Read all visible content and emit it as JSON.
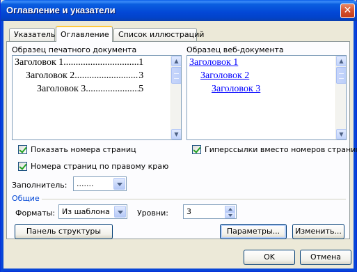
{
  "window": {
    "title": "Оглавление и указатели",
    "close_glyph": "✕"
  },
  "tabs": [
    {
      "label": "Указатель",
      "active": false
    },
    {
      "label": "Оглавление",
      "active": true
    },
    {
      "label": "Список иллюстраций",
      "active": false
    }
  ],
  "print_preview": {
    "label": "Образец печатного документа",
    "lines": [
      {
        "text": "Заголовок 1",
        "dots": "......................................",
        "page": "1"
      },
      {
        "text": "Заголовок 2",
        "dots": "......................................",
        "page": "3"
      },
      {
        "text": "Заголовок 3",
        "dots": "......................................",
        "page": "5"
      }
    ]
  },
  "web_preview": {
    "label": "Образец веб-документа",
    "links": [
      "Заголовок 1",
      "Заголовок 2",
      "Заголовок 3"
    ]
  },
  "options": {
    "show_page_numbers": {
      "label": "Показать номера страниц",
      "checked": true
    },
    "right_align": {
      "label": "Номера страниц по правому краю",
      "checked": true
    },
    "hyperlinks": {
      "label": "Гиперссылки вместо номеров страниц",
      "checked": true
    },
    "tab_leader": {
      "label": "Заполнитель:",
      "value": "......."
    }
  },
  "general": {
    "label": "Общие",
    "formats_label": "Форматы:",
    "formats_value": "Из шаблона",
    "levels_label": "Уровни:",
    "levels_value": "3"
  },
  "buttons": {
    "outline_toolbar": "Панель структуры",
    "options": "Параметры...",
    "modify": "Изменить...",
    "ok": "OK",
    "cancel": "Отмена"
  },
  "colors": {
    "titlebar": "#0347d6",
    "link": "#0000ff",
    "group_label": "#0046d5"
  }
}
